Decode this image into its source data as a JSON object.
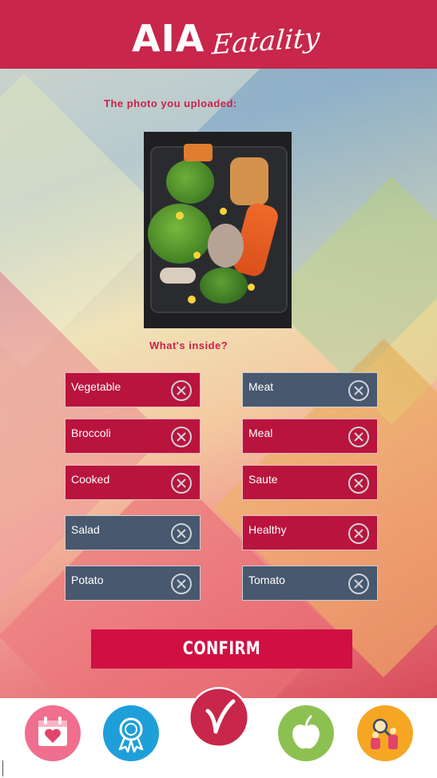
{
  "header": {
    "logo_main": "AIA",
    "logo_script": "Eatality",
    "bg_color": "#c8264a"
  },
  "upload": {
    "label": "The photo you uploaded:",
    "inside_label": "What's inside?"
  },
  "tags": [
    {
      "label": "Vegetable",
      "state": "selected",
      "color": "#b9143d"
    },
    {
      "label": "Meat",
      "state": "unselected",
      "color": "#47586f"
    },
    {
      "label": "Broccoli",
      "state": "selected",
      "color": "#b9143d"
    },
    {
      "label": "Meal",
      "state": "selected",
      "color": "#b9143d"
    },
    {
      "label": "Cooked",
      "state": "selected",
      "color": "#b9143d"
    },
    {
      "label": "Saute",
      "state": "selected",
      "color": "#b9143d"
    },
    {
      "label": "Salad",
      "state": "unselected",
      "color": "#47586f"
    },
    {
      "label": "Healthy",
      "state": "selected",
      "color": "#b9143d"
    },
    {
      "label": "Potato",
      "state": "unselected",
      "color": "#47586f"
    },
    {
      "label": "Tomato",
      "state": "unselected",
      "color": "#47586f"
    }
  ],
  "confirm_label": "CONFIRM",
  "nav": [
    {
      "icon": "calendar-heart-icon",
      "color": "#f06e8e"
    },
    {
      "icon": "award-ribbon-icon",
      "color": "#1e9fd9"
    },
    {
      "icon": "checkmark-logo-icon",
      "color": "#c8264a"
    },
    {
      "icon": "apple-icon",
      "color": "#8cc152"
    },
    {
      "icon": "family-search-icon",
      "color": "#f5a623"
    }
  ]
}
